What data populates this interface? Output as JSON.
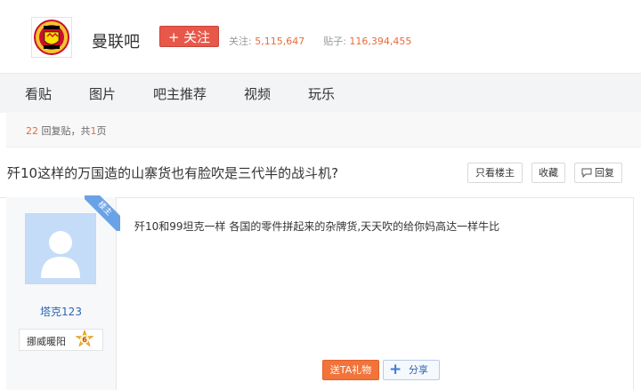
{
  "forum": {
    "name": "曼联吧",
    "follow_label": "+ 关注",
    "followers_label": "关注:",
    "followers_value": "5,115,647",
    "posts_label": "贴子:",
    "posts_value": "116,394,455",
    "logo_icon": "manchester-united-crest-icon"
  },
  "nav": {
    "items": [
      "看贴",
      "图片",
      "吧主推荐",
      "视频",
      "玩乐"
    ]
  },
  "thread": {
    "reply_count": "22",
    "reply_text": "回复贴，共",
    "page_count": "1",
    "page_suffix": "页",
    "title": "歼10这样的万国造的山寨货也有脸吹是三代半的战斗机?",
    "only_op_label": "只看楼主",
    "favorite_label": "收藏",
    "reply_label": "回复"
  },
  "post": {
    "op_tag": "楼主",
    "username": "塔克123",
    "rank_name": "挪威暖阳",
    "level": "6",
    "content": "歼10和99坦克一样 各国的零件拼起来的杂牌货,天天吹的给你妈高达一样牛比",
    "gift_label": "送TA礼物",
    "share_label": "分享"
  },
  "colors": {
    "accent_red": "#e8584a",
    "number_orange": "#e96b3a",
    "link_blue": "#2d64b3",
    "gift_orange": "#f2743b"
  }
}
